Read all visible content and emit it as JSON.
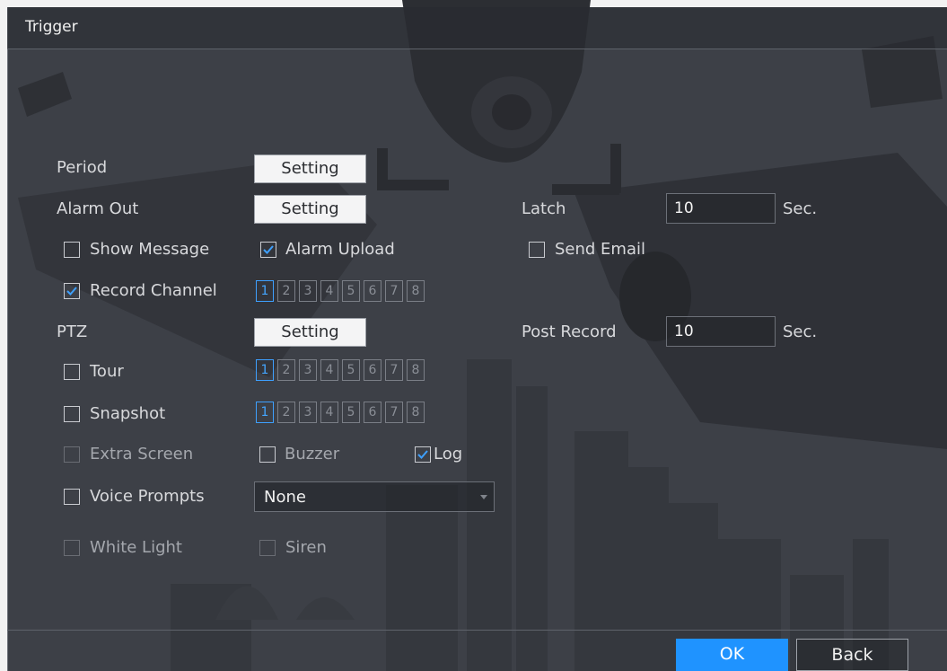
{
  "window": {
    "title": "Trigger"
  },
  "period": {
    "label": "Period",
    "button": "Setting"
  },
  "alarm_out": {
    "label": "Alarm Out",
    "button": "Setting"
  },
  "latch": {
    "label": "Latch",
    "value": "10",
    "unit": "Sec."
  },
  "show_message": {
    "label": "Show Message",
    "checked": false
  },
  "alarm_upload": {
    "label": "Alarm Upload",
    "checked": true
  },
  "send_email": {
    "label": "Send Email",
    "checked": false
  },
  "record_channel": {
    "label": "Record Channel",
    "checked": true,
    "channels": [
      "1",
      "2",
      "3",
      "4",
      "5",
      "6",
      "7",
      "8"
    ],
    "selected": [
      "1"
    ]
  },
  "ptz": {
    "label": "PTZ",
    "button": "Setting"
  },
  "post_record": {
    "label": "Post Record",
    "value": "10",
    "unit": "Sec."
  },
  "tour": {
    "label": "Tour",
    "checked": false,
    "channels": [
      "1",
      "2",
      "3",
      "4",
      "5",
      "6",
      "7",
      "8"
    ],
    "selected": [
      "1"
    ]
  },
  "snapshot": {
    "label": "Snapshot",
    "checked": false,
    "channels": [
      "1",
      "2",
      "3",
      "4",
      "5",
      "6",
      "7",
      "8"
    ],
    "selected": [
      "1"
    ]
  },
  "extra_screen": {
    "label": "Extra Screen",
    "checked": false,
    "disabled": true
  },
  "buzzer": {
    "label": "Buzzer",
    "checked": false
  },
  "log": {
    "label": "Log",
    "checked": true
  },
  "voice_prompts": {
    "label": "Voice Prompts",
    "checked": false,
    "selected": "None"
  },
  "white_light": {
    "label": "White Light",
    "checked": false,
    "disabled": true
  },
  "siren": {
    "label": "Siren",
    "checked": false,
    "disabled": true
  },
  "footer": {
    "ok": "OK",
    "back": "Back"
  },
  "colors": {
    "accent": "#1f93ff",
    "selected_channel": "#3ea0ff"
  }
}
